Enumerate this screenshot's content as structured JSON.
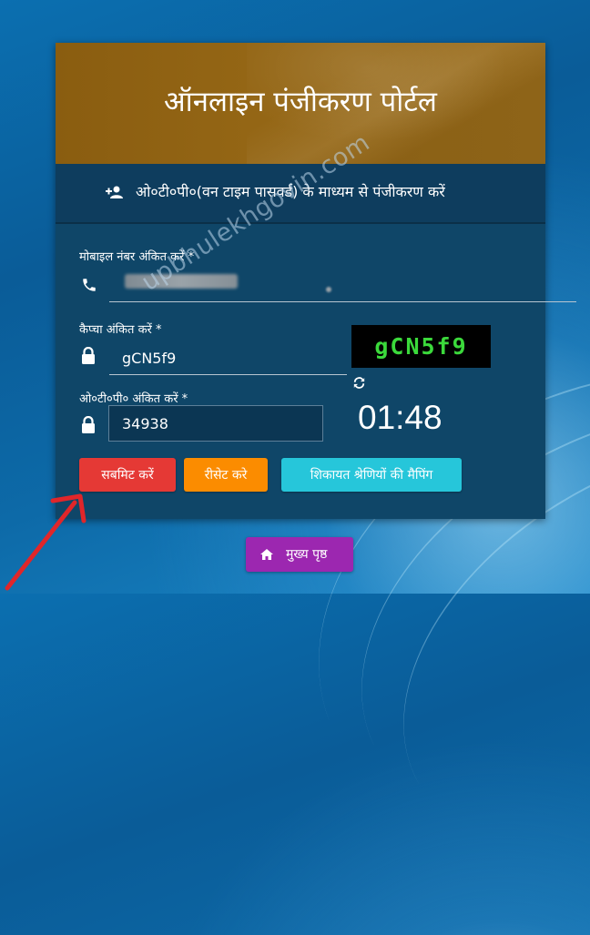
{
  "header": {
    "title": "ऑनलाइन पंजीकरण पोर्टल"
  },
  "subheader": {
    "text": "ओ०टी०पी०(वन टाइम पासवर्ड) के माध्यम से पंजीकरण करें",
    "icon": "add-user-icon"
  },
  "mobile": {
    "label": "मोबाइल नंबर अंकित करें *",
    "icon": "phone-icon"
  },
  "captcha": {
    "label": "कैप्चा अंकित करें *",
    "input_value": "gCN5f9",
    "image_text": "gCN5f9",
    "icon": "lock-icon",
    "refresh_icon": "refresh-icon"
  },
  "otp": {
    "label": "ओ०टी०पी० अंकित करें *",
    "input_value": "34938",
    "icon": "lock-icon"
  },
  "timer": {
    "value": "01:48"
  },
  "buttons": {
    "submit": "सबमिट करें",
    "reset": "रीसेट करे",
    "complaint": "शिकायत श्रेणियों की मैपिंग"
  },
  "home": {
    "label": "मुख्य पृष्ठ",
    "icon": "home-icon"
  },
  "watermark": "upbhulekhgovin.com",
  "colors": {
    "header": "#946615",
    "card": "#0f4668",
    "submit": "#e53935",
    "reset": "#fb8c00",
    "complaint": "#26c6da",
    "home": "#9c27b0",
    "captcha_text": "#3bd93b",
    "arrow": "#e0262a"
  }
}
